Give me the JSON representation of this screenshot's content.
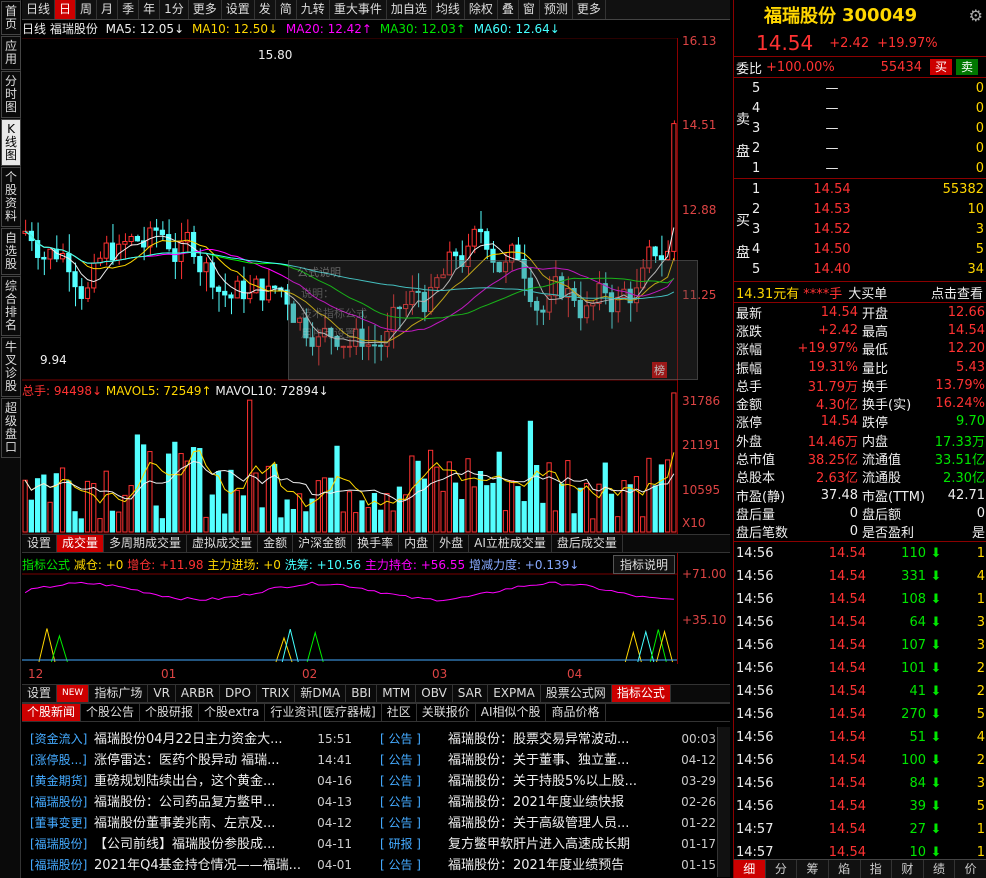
{
  "sidebar": [
    "首页",
    "应用",
    "分时图",
    "K线图",
    "个股资料",
    "自选股",
    "综合排名",
    "牛叉诊股",
    "超级盘口"
  ],
  "topbar": [
    "日线",
    "日",
    "周",
    "月",
    "季",
    "年",
    "1分",
    "更多",
    "设置",
    "发",
    "简",
    "九转",
    "重大事件",
    "加自选",
    "均线",
    "除权",
    "叠",
    "窗",
    "预测",
    "更多"
  ],
  "ma": {
    "label": "日线 福瑞股份",
    "ma5": "MA5: 12.05↓",
    "ma10": "MA10: 12.50↓",
    "ma20": "MA20: 12.42↑",
    "ma30": "MA30: 12.03↑",
    "ma60": "MA60: 12.64↓"
  },
  "kline": {
    "high_label": "15.80",
    "low_label": "9.94",
    "scale": [
      "16.13",
      "14.51",
      "12.88",
      "11.25"
    ],
    "bang": "榜",
    "dialog": {
      "title": "公式说明",
      "lines": [
        "说明：",
        "技术指标公式",
        "用户可设置"
      ]
    }
  },
  "volume": {
    "zong": "总手: 94498↓",
    "mavol5": "MAVOL5: 72549↑",
    "mavol10": "MAVOL10: 72894↓",
    "scale": [
      "31786",
      "21191",
      "10595",
      "X10"
    ]
  },
  "tabs1": [
    "设置",
    "成交量",
    "多周期成交量",
    "虚拟成交量",
    "金额",
    "沪深金额",
    "换手率",
    "内盘",
    "外盘",
    "AI立桩成交量",
    "盘后成交量"
  ],
  "indicator": {
    "name": "指标公式",
    "cang": "减仓: +0",
    "zengcang": "增仓: +11.98",
    "zhuli_in": "主力进场: +0",
    "xipan": "洗筹: +10.56",
    "chicang": "主力持仓: +56.55",
    "zengjian": "增减力度: +0.139↓",
    "explain": "指标说明",
    "scale": [
      "+71.00",
      "+35.10"
    ]
  },
  "months": [
    "12",
    "01",
    "02",
    "03",
    "04"
  ],
  "tabs2": [
    "设置",
    "NEW",
    "指标广场",
    "VR",
    "ARBR",
    "DPO",
    "TRIX",
    "新DMA",
    "BBI",
    "MTM",
    "OBV",
    "SAR",
    "EXPMA",
    "股票公式网",
    "指标公式"
  ],
  "newstabs": [
    "个股新闻",
    "个股公告",
    "个股研报",
    "个股extra",
    "行业资讯[医疗器械]",
    "社区",
    "关联报价",
    "AI相似个股",
    "商品价格"
  ],
  "news_left": [
    {
      "tag": "[资金流入]",
      "title": "福瑞股份04月22日主力资金大...",
      "time": "15:51"
    },
    {
      "tag": "[涨停股...]",
      "title": "涨停雷达：医药个股异动 福瑞...",
      "time": "14:41"
    },
    {
      "tag": "[黄金期货]",
      "title": "重磅规划陆续出台，这个黄金...",
      "time": "04-16"
    },
    {
      "tag": "[福瑞股份]",
      "title": "福瑞股份：公司药品复方鳖甲...",
      "time": "04-13"
    },
    {
      "tag": "[董事变更]",
      "title": "福瑞股份董事姜兆南、左京及...",
      "time": "04-12"
    },
    {
      "tag": "[福瑞股份]",
      "title": "【公司前线】福瑞股份参股成...",
      "time": "04-11"
    },
    {
      "tag": "[福瑞股份]",
      "title": "2021年Q4基金持仓情况——福瑞...",
      "time": "04-01"
    }
  ],
  "news_right": [
    {
      "tag": "[ 公告 ]",
      "title": "福瑞股份：股票交易异常波动...",
      "time": "00:03"
    },
    {
      "tag": "[ 公告 ]",
      "title": "福瑞股份：关于董事、独立董...",
      "time": "04-12"
    },
    {
      "tag": "[ 公告 ]",
      "title": "福瑞股份：关于持股5%以上股...",
      "time": "03-29"
    },
    {
      "tag": "[ 公告 ]",
      "title": "福瑞股份：2021年度业绩快报",
      "time": "02-26"
    },
    {
      "tag": "[ 公告 ]",
      "title": "福瑞股份：关于高级管理人员...",
      "time": "01-22"
    },
    {
      "tag": "[ 研报 ]",
      "title": "复方鳖甲软肝片进入高速成长期",
      "time": "01-17"
    },
    {
      "tag": "[ 公告 ]",
      "title": "福瑞股份：2021年度业绩预告",
      "time": "01-15"
    }
  ],
  "quote": {
    "name": "福瑞股份",
    "code": "300049",
    "price": "14.54",
    "chg": "+2.42",
    "pct": "+19.97%",
    "weibi_label": "委比",
    "weibi": "+100.00%",
    "weicha": "55434",
    "buy_btn": "买",
    "sell_btn": "卖",
    "sell_side_label": [
      "卖",
      "盘"
    ],
    "buy_side_label": [
      "买",
      "盘"
    ],
    "sells": [
      {
        "lv": "5",
        "p": "—",
        "v": "0"
      },
      {
        "lv": "4",
        "p": "—",
        "v": "0"
      },
      {
        "lv": "3",
        "p": "—",
        "v": "0"
      },
      {
        "lv": "2",
        "p": "—",
        "v": "0"
      },
      {
        "lv": "1",
        "p": "—",
        "v": "0"
      }
    ],
    "buys": [
      {
        "lv": "1",
        "p": "14.54",
        "v": "55382"
      },
      {
        "lv": "2",
        "p": "14.53",
        "v": "10"
      },
      {
        "lv": "3",
        "p": "14.52",
        "v": "3"
      },
      {
        "lv": "4",
        "p": "14.50",
        "v": "5"
      },
      {
        "lv": "5",
        "p": "14.40",
        "v": "34"
      }
    ],
    "bigorder": {
      "a": "14.31元有",
      "b": "****手",
      "c": "大买单",
      "d": "点击查看"
    },
    "stats": [
      [
        "最新",
        "14.54",
        "开盘",
        "12.66"
      ],
      [
        "涨跌",
        "+2.42",
        "最高",
        "14.54"
      ],
      [
        "涨幅",
        "+19.97%",
        "最低",
        "12.20"
      ],
      [
        "振幅",
        "19.31%",
        "量比",
        "5.43"
      ],
      [
        "总手",
        "31.79万",
        "换手",
        "13.79%"
      ],
      [
        "金额",
        "4.30亿",
        "换手(实)",
        "16.24%"
      ],
      [
        "涨停",
        "14.54",
        "跌停",
        "9.70"
      ],
      [
        "外盘",
        "14.46万",
        "内盘",
        "17.33万"
      ],
      [
        "总市值",
        "38.25亿",
        "流通值",
        "33.51亿"
      ],
      [
        "总股本",
        "2.63亿",
        "流通股",
        "2.30亿"
      ],
      [
        "市盈(静)",
        "37.48",
        "市盈(TTM)",
        "42.71"
      ],
      [
        "盘后量",
        "0",
        "盘后额",
        "0"
      ],
      [
        "盘后笔数",
        "0",
        "是否盈利",
        "是"
      ]
    ],
    "ticks": [
      {
        "t": "14:56",
        "p": "14.54",
        "v": "110",
        "n": "1"
      },
      {
        "t": "14:56",
        "p": "14.54",
        "v": "331",
        "n": "4"
      },
      {
        "t": "14:56",
        "p": "14.54",
        "v": "108",
        "n": "1"
      },
      {
        "t": "14:56",
        "p": "14.54",
        "v": "64",
        "n": "3"
      },
      {
        "t": "14:56",
        "p": "14.54",
        "v": "107",
        "n": "3"
      },
      {
        "t": "14:56",
        "p": "14.54",
        "v": "101",
        "n": "2"
      },
      {
        "t": "14:56",
        "p": "14.54",
        "v": "41",
        "n": "2"
      },
      {
        "t": "14:56",
        "p": "14.54",
        "v": "270",
        "n": "5"
      },
      {
        "t": "14:56",
        "p": "14.54",
        "v": "51",
        "n": "4"
      },
      {
        "t": "14:56",
        "p": "14.54",
        "v": "100",
        "n": "2"
      },
      {
        "t": "14:56",
        "p": "14.54",
        "v": "84",
        "n": "3"
      },
      {
        "t": "14:56",
        "p": "14.54",
        "v": "39",
        "n": "5"
      },
      {
        "t": "14:57",
        "p": "14.54",
        "v": "27",
        "n": "1"
      },
      {
        "t": "14:57",
        "p": "14.54",
        "v": "10",
        "n": "1"
      }
    ],
    "bottomtabs": [
      "细",
      "分",
      "筹",
      "焰",
      "指",
      "财",
      "绩",
      "价"
    ]
  },
  "colors": {
    "up": "#ff3232",
    "down": "#54ffff",
    "accent": "#ffd700"
  }
}
